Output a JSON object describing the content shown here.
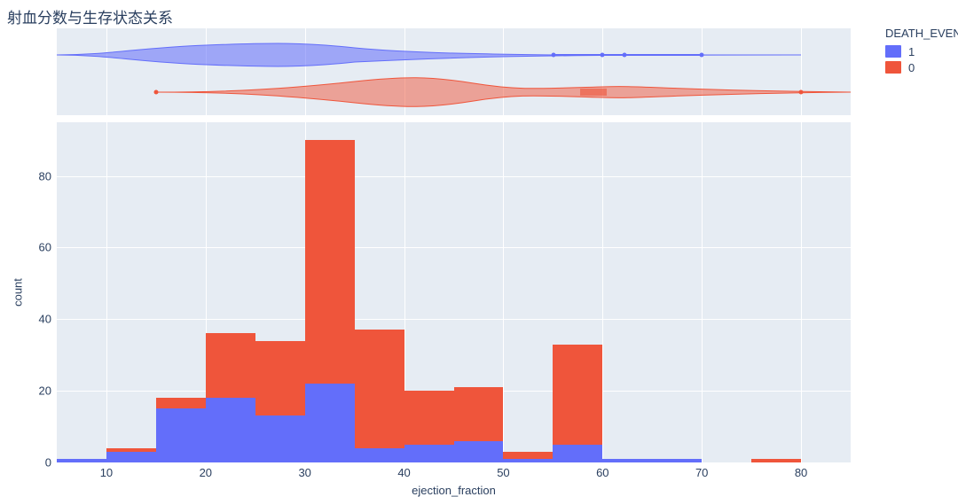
{
  "title": "射血分数与生存状态关系",
  "legend": {
    "title": "DEATH_EVENT",
    "items": [
      {
        "label": "1",
        "color": "#636efa"
      },
      {
        "label": "0",
        "color": "#ef553b"
      }
    ]
  },
  "axes": {
    "x_label": "ejection_fraction",
    "y_label": "count",
    "x_ticks": [
      10,
      20,
      30,
      40,
      50,
      60,
      70,
      80
    ],
    "y_ticks": [
      0,
      20,
      40,
      60,
      80
    ]
  },
  "colors": {
    "panel_bg": "#e6ecf3",
    "grid": "#ffffff",
    "series_1": "#636efa",
    "series_0": "#ef553b"
  },
  "chart_data": {
    "type": "bar",
    "title": "射血分数与生存状态关系",
    "xlabel": "ejection_fraction",
    "ylabel": "count",
    "x_range": [
      5,
      85
    ],
    "y_range": [
      0,
      95
    ],
    "bin_edges": [
      5,
      10,
      15,
      20,
      25,
      30,
      35,
      40,
      45,
      50,
      55,
      60,
      65,
      70,
      75,
      80,
      85
    ],
    "series": [
      {
        "name": "1",
        "color": "#636efa",
        "values": [
          1,
          3,
          15,
          18,
          13,
          22,
          4,
          5,
          6,
          1,
          5,
          1,
          1,
          0,
          0,
          0
        ]
      },
      {
        "name": "0",
        "color": "#ef553b",
        "values": [
          0,
          4,
          18,
          36,
          34,
          90,
          37,
          20,
          21,
          3,
          33,
          1,
          0,
          0,
          1,
          0
        ]
      }
    ],
    "marginal": {
      "type": "violin",
      "series": [
        {
          "name": "1",
          "color": "#636efa",
          "extent": [
            5,
            80
          ],
          "box_whiskers": [
            55,
            60,
            62,
            70
          ]
        },
        {
          "name": "0",
          "color": "#ef553b",
          "extent": [
            15,
            85
          ],
          "box_right": 60,
          "outlier": 80
        }
      ]
    }
  }
}
